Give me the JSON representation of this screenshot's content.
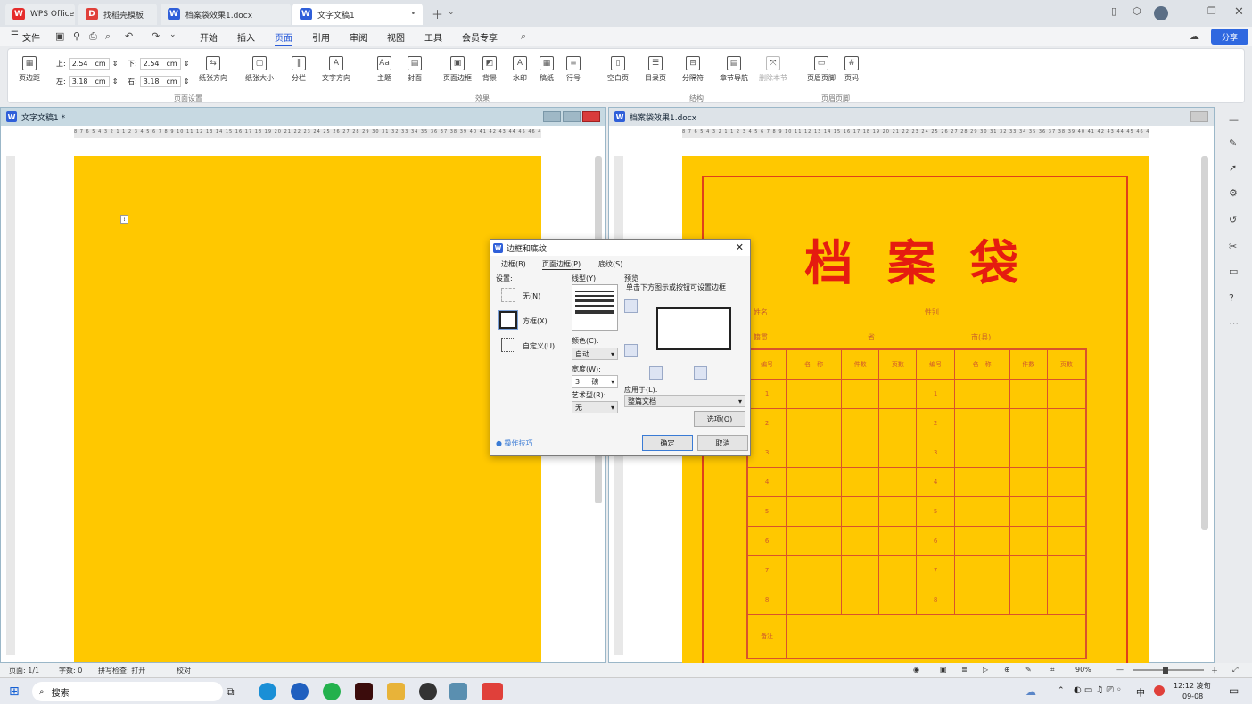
{
  "tabs": [
    {
      "label": "WPS Office",
      "icon": "wps-icon",
      "iconglyph": "W"
    },
    {
      "label": "找稻壳模板",
      "icon": "docer-icon",
      "iconglyph": "D"
    },
    {
      "label": "档案袋效果1.docx",
      "icon": "word-icon",
      "iconglyph": "W"
    },
    {
      "label": "文字文稿1",
      "icon": "word-icon",
      "iconglyph": "W",
      "active": true
    }
  ],
  "menus": [
    "文件",
    "开始",
    "插入",
    "页面",
    "引用",
    "审阅",
    "视图",
    "工具",
    "会员专享"
  ],
  "active_menu": "页面",
  "share_label": "分享",
  "ribbon": {
    "margins": {
      "top_label": "上:",
      "top_value": "2.54",
      "bottom_label": "下:",
      "bottom_value": "2.54",
      "left_label": "左:",
      "left_value": "3.18",
      "right_label": "右:",
      "right_value": "3.18",
      "unit": "cm"
    },
    "buttons": [
      "页边距",
      "纸张方向",
      "纸张大小",
      "分栏",
      "文字方向",
      "主题",
      "封面",
      "页面边框",
      "背景",
      "水印",
      "稿纸",
      "行号",
      "空白页",
      "目录页",
      "分隔符",
      "章节导航",
      "删除本节",
      "页眉页脚",
      "页码"
    ],
    "groups": [
      "页面设置",
      "效果",
      "结构",
      "页眉页脚"
    ]
  },
  "left_doc": {
    "title": "文字文稿1 *"
  },
  "right_doc": {
    "title": "档案袋效果1.docx",
    "heading": "档 案 袋",
    "fields": [
      "姓名",
      "性别",
      "籍贯",
      "省",
      "市(县)"
    ],
    "table_headers": [
      "编号",
      "名　称",
      "件数",
      "页数",
      "编号",
      "名　称",
      "件数",
      "页数"
    ],
    "rows_left": [
      "1",
      "2",
      "3",
      "4",
      "5",
      "6",
      "7",
      "8"
    ],
    "rows_right": [
      "1",
      "2",
      "3",
      "4",
      "5",
      "6",
      "7",
      "8"
    ],
    "footer_label": "备注"
  },
  "ruler_text": "8 7 6 5 4 3 2 1  1 2 3 4 5 6 7 8 9 10 11 12 13 14 15 16 17 18 19 20 21 22 23 24 25 26 27 28 29 30 31 32 33 34 35 36 37 38 39 40 41 42 43 44 45 46 47",
  "dialog": {
    "title": "边框和底纹",
    "tabs": [
      "边框(B)",
      "页面边框(P)",
      "底纹(S)"
    ],
    "setting_label": "设置:",
    "settings": [
      "无(N)",
      "方框(X)",
      "自定义(U)"
    ],
    "line_style_label": "线型(Y):",
    "color_label": "颜色(C):",
    "color_value": "自动",
    "width_label": "宽度(W):",
    "width_value": "3",
    "width_unit": "磅",
    "art_label": "艺术型(R):",
    "art_value": "无",
    "preview_label": "预览",
    "preview_hint": "单击下方图示或按钮可设置边框",
    "apply_label": "应用于(L):",
    "apply_value": "整篇文档",
    "options_button": "选项(O)",
    "tips_link": "操作技巧",
    "ok_button": "确定",
    "cancel_button": "取消"
  },
  "status": {
    "page": "页面: 1/1",
    "words": "字数: 0",
    "spell": "拼写检查: 打开",
    "proof": "校对",
    "zoom": "90%"
  },
  "taskbar": {
    "search": "搜索",
    "time": "12:12 凌旬",
    "date": "09-08",
    "ime": "中"
  }
}
